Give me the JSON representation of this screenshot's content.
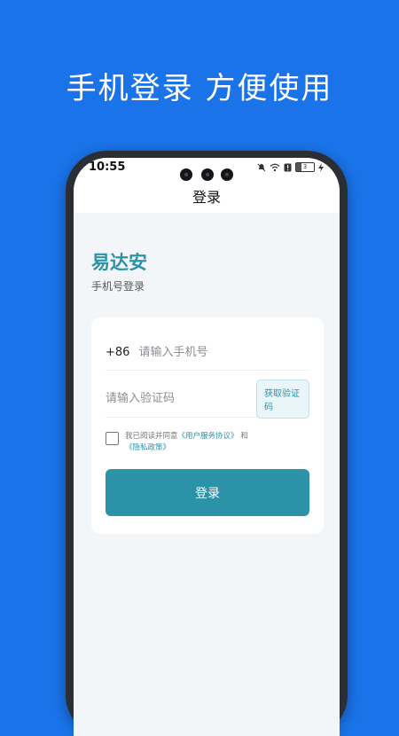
{
  "promo": {
    "title": "手机登录 方便使用"
  },
  "status_bar": {
    "time": "10:55",
    "battery": "3"
  },
  "nav": {
    "title": "登录"
  },
  "brand": {
    "name": "易达安",
    "subtitle": "手机号登录"
  },
  "form": {
    "phone_prefix": "+86",
    "phone_placeholder": "请输入手机号",
    "phone_value": "",
    "code_placeholder": "请输入验证码",
    "code_value": "",
    "get_code_label": "获取验证码",
    "agreement_prefix": "我已阅读并同意",
    "user_agreement": "《用户服务协议》",
    "agreement_and": "和",
    "privacy_policy": "《隐私政策》",
    "agreement_checked": false,
    "login_label": "登录"
  },
  "colors": {
    "background": "#1a73e8",
    "accent": "#2b92a8"
  }
}
